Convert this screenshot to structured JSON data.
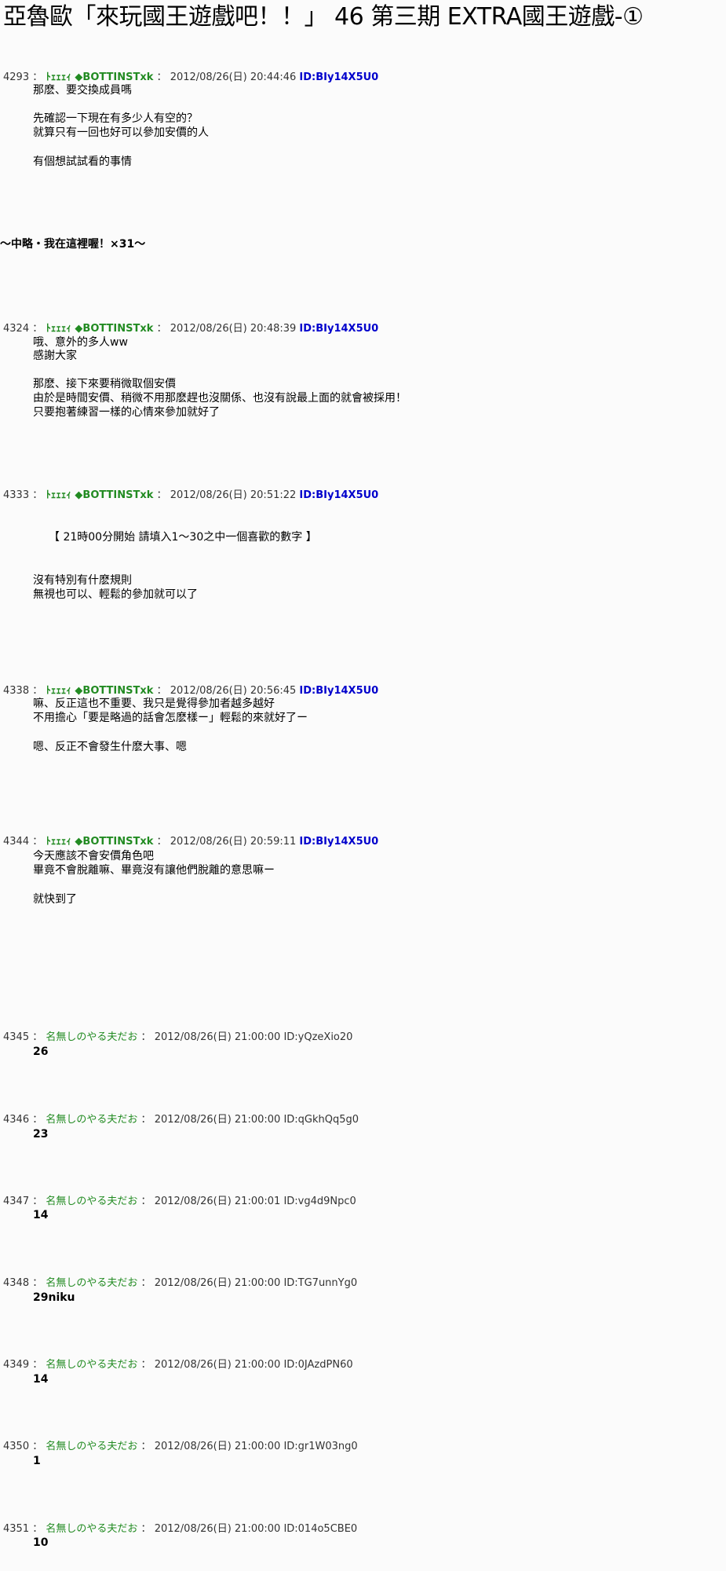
{
  "title": "亞魯歐「來玩國王遊戲吧！！」 46  第三期  EXTRA國王遊戲-①",
  "separator": "：",
  "omit_note": "～中略・我在這裡喔！×31～",
  "posts": [
    {
      "number": "4293",
      "name": "ﾄｪｪｪｨ ◆BOTTINSTxk",
      "datetime": "2012/08/26(日) 20:44:46",
      "id": "ID:BIy14X5U0",
      "lines": [
        "那麽、要交換成員嗎",
        "先確認一下現在有多少人有空的？",
        "就算只有一回也好可以參加安價的人",
        "有個想試試看的事情"
      ]
    },
    {
      "number": "4324",
      "name": "ﾄｪｪｪｨ ◆BOTTINSTxk",
      "datetime": "2012/08/26(日) 20:48:39",
      "id": "ID:BIy14X5U0",
      "lines": [
        "哦、意外的多人ww",
        "感謝大家",
        "那麽、接下來要稍微取個安價",
        "由於是時間安價、稍微不用那麽趕也沒關係、也沒有說最上面的就會被採用！",
        "只要抱著練習一樣的心情來參加就好了"
      ]
    },
    {
      "number": "4333",
      "name": "ﾄｪｪｪｨ ◆BOTTINSTxk",
      "datetime": "2012/08/26(日) 20:51:22",
      "id": "ID:BIy14X5U0",
      "lines": [
        "【  21時00分開始     請填入1～30之中一個喜歡的數字  】",
        "沒有特別有什麽規則",
        "無視也可以、輕鬆的參加就可以了"
      ]
    },
    {
      "number": "4338",
      "name": "ﾄｪｪｪｨ ◆BOTTINSTxk",
      "datetime": "2012/08/26(日) 20:56:45",
      "id": "ID:BIy14X5U0",
      "lines": [
        "嘛、反正這也不重要、我只是覺得參加者越多越好",
        "不用擔心「要是略過的話會怎麽樣ー」輕鬆的來就好了ー",
        "嗯、反正不會發生什麽大事、嗯"
      ]
    },
    {
      "number": "4344",
      "name": "ﾄｪｪｪｨ ◆BOTTINSTxk",
      "datetime": "2012/08/26(日) 20:59:11",
      "id": "ID:BIy14X5U0",
      "lines": [
        "今天應該不會安價角色吧",
        "畢竟不會脫離嘛、畢竟沒有讓他們脫離的意思嘛ー",
        "就快到了"
      ]
    },
    {
      "number": "4345",
      "name": "名無しのやる夫だお",
      "datetime": "2012/08/26(日) 21:00:00",
      "id": "ID:yQzeXio20",
      "lines": [
        "26"
      ]
    },
    {
      "number": "4346",
      "name": "名無しのやる夫だお",
      "datetime": "2012/08/26(日) 21:00:00",
      "id": "ID:qGkhQq5g0",
      "lines": [
        "23"
      ]
    },
    {
      "number": "4347",
      "name": "名無しのやる夫だお",
      "datetime": "2012/08/26(日) 21:00:01",
      "id": "ID:vg4d9Npc0",
      "lines": [
        "14"
      ]
    },
    {
      "number": "4348",
      "name": "名無しのやる夫だお",
      "datetime": "2012/08/26(日) 21:00:00",
      "id": "ID:TG7unnYg0",
      "lines": [
        "29niku"
      ]
    },
    {
      "number": "4349",
      "name": "名無しのやる夫だお",
      "datetime": "2012/08/26(日) 21:00:00",
      "id": "ID:0JAzdPN60",
      "lines": [
        "14"
      ]
    },
    {
      "number": "4350",
      "name": "名無しのやる夫だお",
      "datetime": "2012/08/26(日) 21:00:00",
      "id": "ID:gr1W03ng0",
      "lines": [
        "1"
      ]
    },
    {
      "number": "4351",
      "name": "名無しのやる夫だお",
      "datetime": "2012/08/26(日) 21:00:00",
      "id": "ID:014o5CBE0",
      "lines": [
        "10"
      ]
    }
  ]
}
